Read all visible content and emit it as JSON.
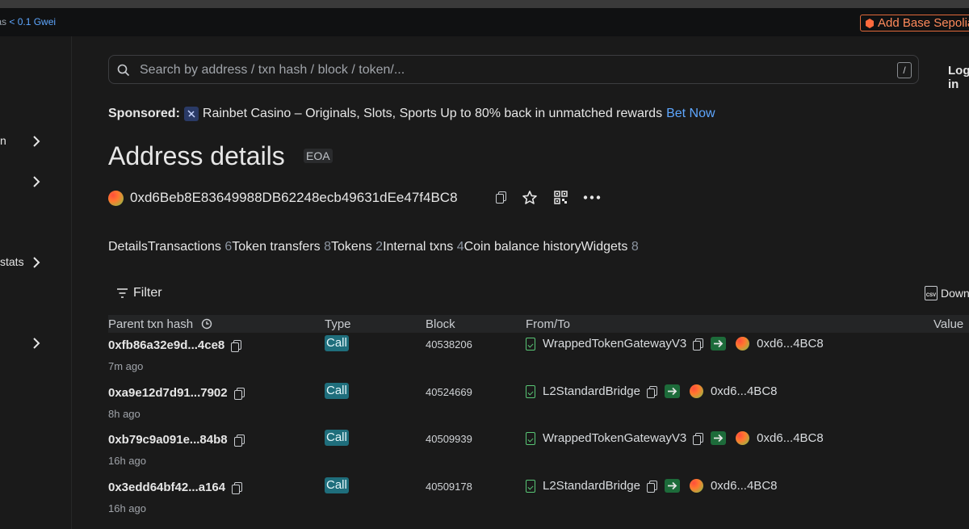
{
  "topbar": {
    "gas_label": "Gas",
    "gas_value": "< 0.1 Gwei",
    "add_network": "Add Base Sepolia"
  },
  "sidebar": {
    "items": [
      {
        "label": "n"
      },
      {
        "label": ""
      },
      {
        "label": "stats"
      },
      {
        "label": ""
      }
    ]
  },
  "search": {
    "placeholder": "Search by address / txn hash / block / token/...",
    "shortcut": "/"
  },
  "header": {
    "login": "Log in"
  },
  "sponsored": {
    "label": "Sponsored:",
    "text": "Rainbet Casino – Originals, Slots, Sports Up to 80% back in unmatched rewards",
    "link": "Bet Now"
  },
  "page": {
    "title": "Address details",
    "badge": "EOA",
    "address": "0xd6Beb8E83649988DB62248ecb49631dEe47f4BC8"
  },
  "tabs": [
    {
      "label": "Details",
      "count": ""
    },
    {
      "label": "Transactions",
      "count": "6"
    },
    {
      "label": "Token transfers",
      "count": "8"
    },
    {
      "label": "Tokens",
      "count": "2"
    },
    {
      "label": "Internal txns",
      "count": "4"
    },
    {
      "label": "Coin balance history",
      "count": ""
    },
    {
      "label": "Widgets",
      "count": "8"
    }
  ],
  "toolbar": {
    "filter": "Filter",
    "download": "Download"
  },
  "table": {
    "headers": [
      "Parent txn hash",
      "Type",
      "Block",
      "From/To",
      "Value"
    ],
    "rows": [
      {
        "hash": "0xfb86a32e9d...4ce8",
        "age": "7m ago",
        "type": "Call",
        "block": "40538206",
        "from": "WrappedTokenGatewayV3",
        "to": "0xd6...4BC8"
      },
      {
        "hash": "0xa9e12d7d91...7902",
        "age": "8h ago",
        "type": "Call",
        "block": "40524669",
        "from": "L2StandardBridge",
        "to": "0xd6...4BC8"
      },
      {
        "hash": "0xb79c9a091e...84b8",
        "age": "16h ago",
        "type": "Call",
        "block": "40509939",
        "from": "WrappedTokenGatewayV3",
        "to": "0xd6...4BC8"
      },
      {
        "hash": "0x3edd64bf42...a164",
        "age": "16h ago",
        "type": "Call",
        "block": "40509178",
        "from": "L2StandardBridge",
        "to": "0xd6...4BC8"
      }
    ]
  },
  "colors": {
    "background": "#1a1a1a",
    "link": "#5ea7ff",
    "call_badge": "#1f6e7c",
    "direction_badge": "#1d6b3a",
    "accent_orange": "#ff8a5b"
  }
}
